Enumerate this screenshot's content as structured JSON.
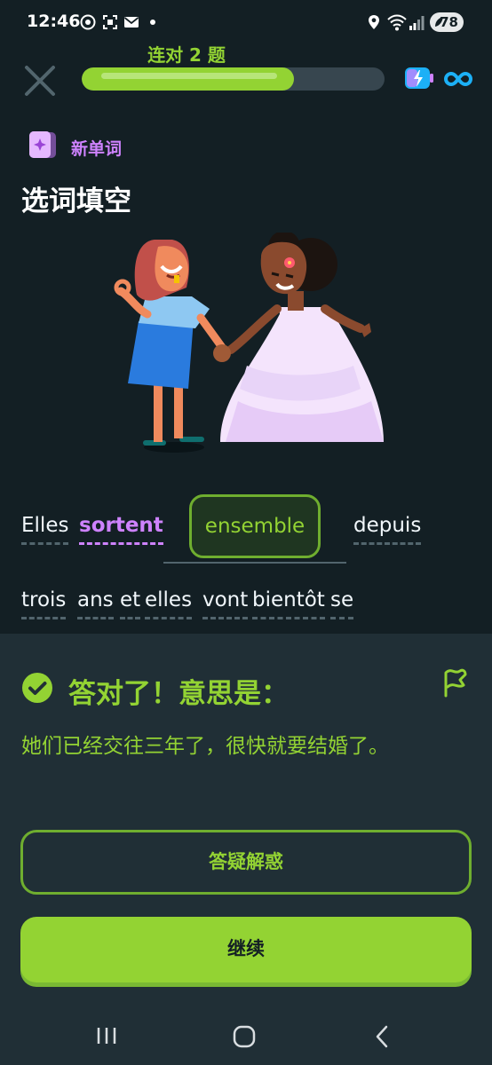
{
  "status_bar": {
    "time": "12:46",
    "battery": "78"
  },
  "progress": {
    "streak": "连对 2 题",
    "value": 0.7
  },
  "header": {
    "badge_label": "新单词",
    "title": "选词填空"
  },
  "sentence": {
    "line1": [
      {
        "text": "Elles",
        "style": "normal"
      },
      {
        "text": "sortent",
        "style": "highlight"
      }
    ],
    "answer": "ensemble",
    "after_answer": "depuis",
    "line2": [
      "trois",
      "ans",
      "et",
      "elles",
      "vont",
      "bientôt",
      "se"
    ]
  },
  "feedback": {
    "heading": "答对了！意思是：",
    "meaning": "她们已经交往三年了，很快就要结婚了。",
    "explain_label": "答疑解惑",
    "continue_label": "继续"
  },
  "colors": {
    "background": "#131f24",
    "panel": "#202f36",
    "accent_green": "#93d333",
    "accent_purple": "#ce82ff"
  },
  "icons": [
    "close-icon",
    "energy-icon",
    "infinity-icon",
    "new-word-icon",
    "check-circle-icon",
    "report-flag-icon",
    "nav-recents-icon",
    "nav-home-icon",
    "nav-back-icon"
  ]
}
